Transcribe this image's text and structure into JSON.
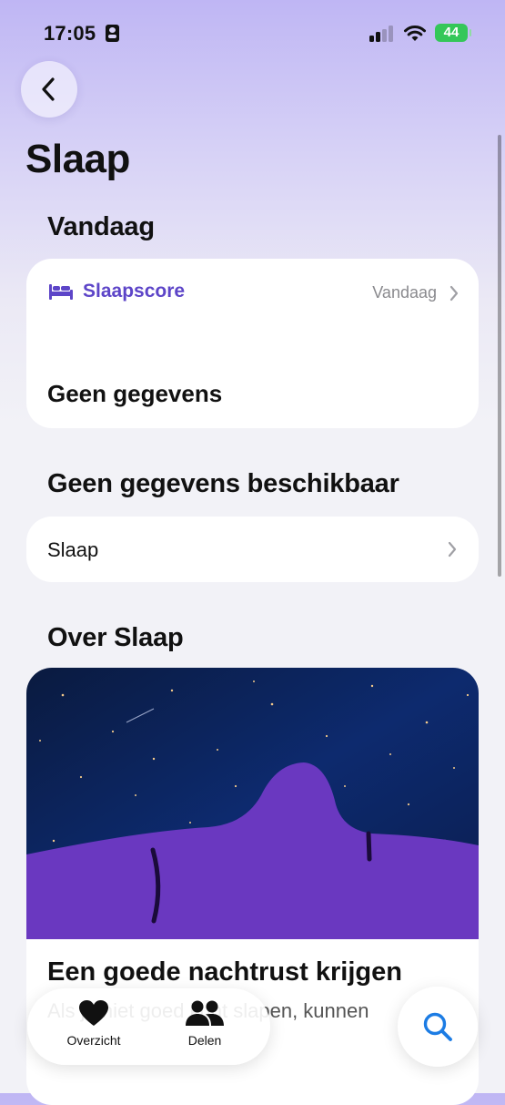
{
  "status_bar": {
    "time": "17:05",
    "battery": "44"
  },
  "header": {
    "title": "Slaap"
  },
  "today": {
    "section_title": "Vandaag",
    "score_card": {
      "label": "Slaapscore",
      "date": "Vandaag",
      "value": "Geen gegevens",
      "accent_color": "#5d45c8"
    }
  },
  "unavailable": {
    "section_title": "Geen gegevens beschikbaar",
    "row_label": "Slaap"
  },
  "about": {
    "section_title": "Over Slaap",
    "article_title": "Een goede nachtrust krijgen",
    "article_text": "Als je niet goed kunt slapen, kunnen"
  },
  "tabbar": {
    "items": [
      {
        "label": "Overzicht",
        "icon": "heart-icon"
      },
      {
        "label": "Delen",
        "icon": "people-icon"
      }
    ],
    "search_icon": "search-icon",
    "search_color": "#1c7ce4"
  }
}
